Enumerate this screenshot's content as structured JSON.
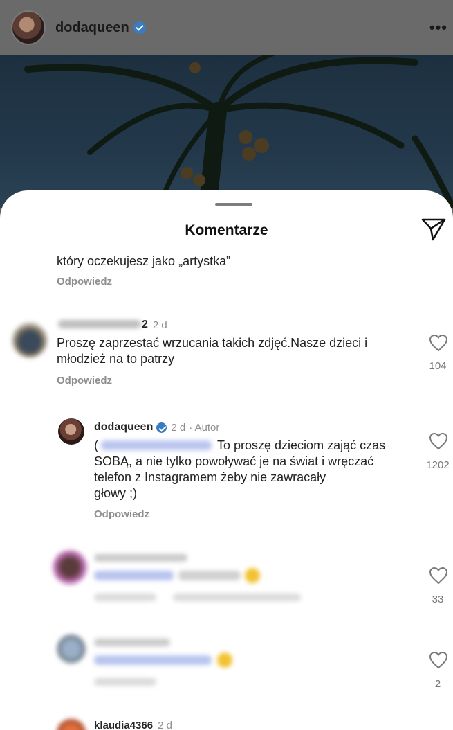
{
  "post": {
    "username": "dodaqueen",
    "more_label": "•••"
  },
  "sheet": {
    "title": "Komentarze"
  },
  "comments": [
    {
      "text_line1": "który oczekujesz jako „artystka”",
      "reply_label": "Odpowiedz"
    },
    {
      "username_suffix": "2",
      "time": "2 d",
      "text_line1": "Proszę zaprzestać wrzucania takich zdjęć.Nasze dzieci i",
      "text_line2": "młodzież na to patrzy",
      "reply_label": "Odpowiedz",
      "likes": "104"
    },
    {
      "username": "dodaqueen",
      "time": "2 d",
      "author_tag": "· Autor",
      "mention_open": "(",
      "text_line1": "To proszę dzieciom zająć czas",
      "text_line2": "SOBĄ, a nie tylko powoływać je na świat i wręczać",
      "text_line3": "telefon z Instagramem  żeby nie zawracały",
      "text_line4": "głowy ;)",
      "reply_label": "Odpowiedz",
      "likes": "1202"
    },
    {
      "likes": "33"
    },
    {
      "likes": "2"
    },
    {
      "username": "klaudia4366",
      "time": "2 d"
    }
  ],
  "colors": {
    "verified": "#3b7bbf",
    "mention": "#4a6fd0",
    "secondary_text": "#8e8e8e"
  }
}
